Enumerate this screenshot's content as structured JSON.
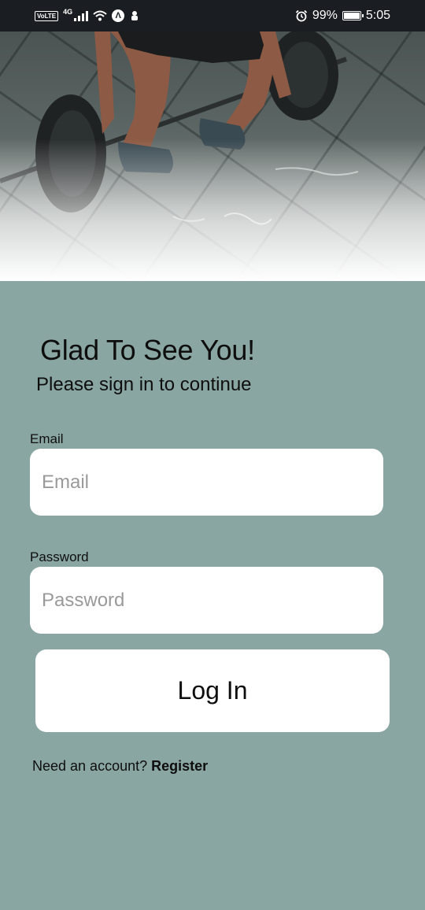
{
  "status_bar": {
    "network": "4G",
    "volte": "VoLTE",
    "battery": "99%",
    "battery_level": 0.99,
    "time": "5:05",
    "icons": [
      "volte-icon",
      "signal-icon",
      "wifi-icon",
      "app-notification-icon",
      "usb-debug-icon",
      "alarm-icon",
      "battery-icon"
    ]
  },
  "hero": {
    "image": "barbell-deadlift-photo"
  },
  "login": {
    "heading": "Glad To See You!",
    "subheading": "Please sign in to continue",
    "email_label": "Email",
    "email_placeholder": "Email",
    "email_value": "",
    "password_label": "Password",
    "password_placeholder": "Password",
    "password_value": "",
    "submit_label": "Log In",
    "register_prompt": "Need an account? ",
    "register_link": "Register"
  },
  "colors": {
    "background": "#8aa6a2",
    "status_bar": "#1a1e22",
    "card": "#ffffff"
  }
}
